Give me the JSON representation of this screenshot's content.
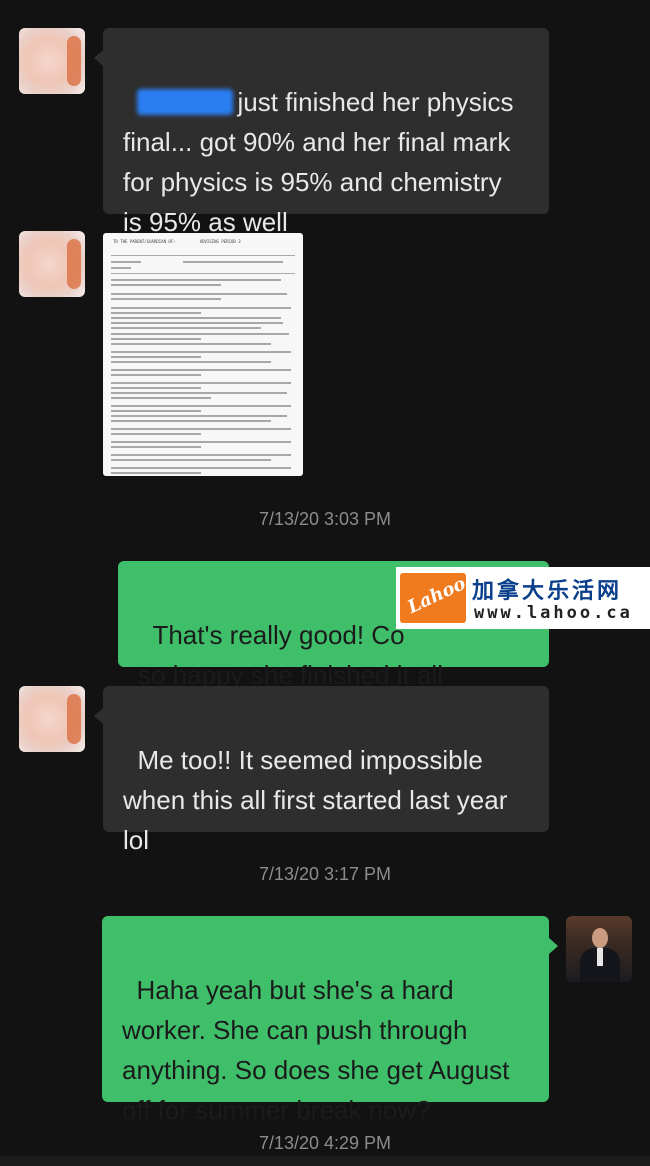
{
  "messages": [
    {
      "id": "m1",
      "text": "just finished her physics\nfinal... got 90% and her final mark\nfor physics is 95% and chemistry\nis 95% as well"
    },
    {
      "id": "m2",
      "attachment": "report-card-image"
    },
    {
      "id": "t1",
      "timestamp": "7/13/20 3:03 PM"
    },
    {
      "id": "m3",
      "text": "That's really good! Co\nso happy she finished it all"
    },
    {
      "id": "m4",
      "text": "Me too!! It seemed impossible\nwhen this all first started last year\nlol"
    },
    {
      "id": "t2",
      "timestamp": "7/13/20 3:17 PM"
    },
    {
      "id": "m5",
      "text": "Haha yeah but she's a hard\nworker. She can push through\nanything. So does she get August\noff for summer break now?"
    },
    {
      "id": "t3",
      "timestamp": "7/13/20 4:29 PM"
    }
  ],
  "watermark": {
    "logo_text": "Lahoo",
    "title": "加拿大乐活网",
    "url": "www.lahoo.ca"
  },
  "icons": {
    "contact_avatar": "blurred-avatar",
    "user_avatar": "user-photo-avatar"
  },
  "colors": {
    "background": "#121212",
    "incoming_bubble": "#2e2e2e",
    "outgoing_bubble": "#3fbf6a",
    "timestamp": "#8c8c8c",
    "watermark_brand": "#f07a1e"
  }
}
